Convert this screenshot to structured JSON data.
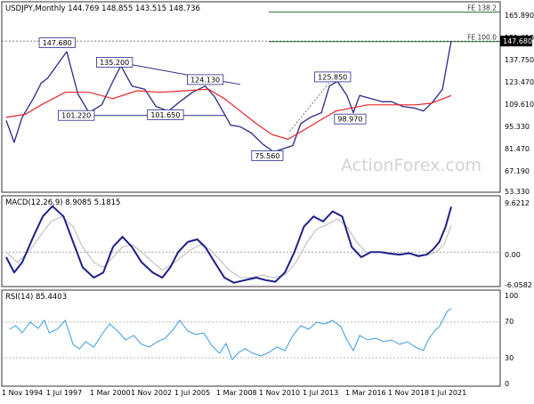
{
  "chart_data": [
    {
      "type": "candlestick",
      "title": "USDJPY,Monthly  144.769 148.855 143.515 148.736",
      "ohlc_last": {
        "open": 144.769,
        "high": 148.855,
        "low": 143.515,
        "close": 148.736
      },
      "y_ticks": [
        "165.890",
        "151.610",
        "137.750",
        "123.470",
        "109.610",
        "95.330",
        "81.470",
        "67.190",
        "53.330"
      ],
      "ylim": [
        53.33,
        167.0
      ],
      "last_price_label": "147.680",
      "fib_levels": [
        {
          "label": "FE 138.2",
          "value": 167.2
        },
        {
          "label": "FE 100.0",
          "value": 148.4
        }
      ],
      "annotations": [
        {
          "label": "147.680",
          "x_year": 1998.0,
          "value": 147.68
        },
        {
          "label": "135.200",
          "x_year": 2001.6,
          "value": 135.2
        },
        {
          "label": "124.130",
          "x_year": 2007.3,
          "value": 124.13
        },
        {
          "label": "101.220",
          "x_year": 1999.2,
          "value": 101.22
        },
        {
          "label": "101.650",
          "x_year": 2004.8,
          "value": 101.65
        },
        {
          "label": "125.850",
          "x_year": 2015.3,
          "value": 125.85
        },
        {
          "label": "98.970",
          "x_year": 2016.4,
          "value": 98.97
        },
        {
          "label": "75.560",
          "x_year": 2011.2,
          "value": 75.56
        }
      ],
      "x_labels": [
        "1 Nov 1994",
        "1 Jul 1997",
        "1 Mar 2000",
        "1 Nov 2002",
        "1 Jul 2005",
        "1 Mar 2008",
        "1 Nov 2010",
        "1 Jul 2013",
        "1 Mar 2016",
        "1 Nov 2018",
        "1 Jul 2021"
      ],
      "price_series": [
        [
          1994.8,
          98
        ],
        [
          1995.3,
          84
        ],
        [
          1995.8,
          100
        ],
        [
          1996.5,
          112
        ],
        [
          1997.0,
          122
        ],
        [
          1997.4,
          125
        ],
        [
          1998.6,
          142
        ],
        [
          1999.3,
          115
        ],
        [
          2000.0,
          103
        ],
        [
          2000.8,
          108
        ],
        [
          2001.5,
          123
        ],
        [
          2002.0,
          133
        ],
        [
          2002.7,
          120
        ],
        [
          2003.5,
          118
        ],
        [
          2004.2,
          107
        ],
        [
          2005.0,
          104
        ],
        [
          2005.7,
          110
        ],
        [
          2006.5,
          116
        ],
        [
          2007.3,
          120
        ],
        [
          2007.9,
          113
        ],
        [
          2008.4,
          104
        ],
        [
          2008.9,
          95
        ],
        [
          2009.5,
          94
        ],
        [
          2010.2,
          90
        ],
        [
          2010.9,
          83
        ],
        [
          2011.6,
          78
        ],
        [
          2012.2,
          80
        ],
        [
          2012.8,
          82
        ],
        [
          2013.3,
          96
        ],
        [
          2013.9,
          100
        ],
        [
          2014.6,
          103
        ],
        [
          2015.1,
          120
        ],
        [
          2015.6,
          123
        ],
        [
          2016.2,
          114
        ],
        [
          2016.6,
          103
        ],
        [
          2017.0,
          114
        ],
        [
          2017.7,
          112
        ],
        [
          2018.4,
          110
        ],
        [
          2019.0,
          110
        ],
        [
          2019.7,
          107
        ],
        [
          2020.4,
          106
        ],
        [
          2021.0,
          104
        ],
        [
          2021.6,
          110
        ],
        [
          2022.2,
          118
        ],
        [
          2022.5,
          135
        ],
        [
          2022.75,
          148.7
        ]
      ],
      "ma_series": [
        [
          1994.8,
          100
        ],
        [
          1996.0,
          102
        ],
        [
          1997.0,
          108
        ],
        [
          1998.5,
          116
        ],
        [
          2000.0,
          116
        ],
        [
          2001.5,
          112
        ],
        [
          2003.0,
          117
        ],
        [
          2004.5,
          116
        ],
        [
          2006.0,
          117
        ],
        [
          2007.5,
          118
        ],
        [
          2008.5,
          112
        ],
        [
          2009.5,
          104
        ],
        [
          2010.5,
          96
        ],
        [
          2011.5,
          89
        ],
        [
          2012.5,
          86
        ],
        [
          2013.5,
          92
        ],
        [
          2014.5,
          98
        ],
        [
          2015.5,
          104
        ],
        [
          2016.5,
          106
        ],
        [
          2017.5,
          108
        ],
        [
          2018.5,
          108
        ],
        [
          2019.5,
          108
        ],
        [
          2020.5,
          108
        ],
        [
          2021.5,
          109
        ],
        [
          2022.75,
          114
        ]
      ]
    },
    {
      "type": "line",
      "title": "MACD(12,26,9) 8.9085 5.1815",
      "y_ticks": [
        "9.6212",
        "0.00",
        "-6.0582"
      ],
      "ylim": [
        -6.4,
        10.0
      ],
      "series": [
        {
          "name": "MACD",
          "values": [
            [
              1994.8,
              -1
            ],
            [
              1995.3,
              -4
            ],
            [
              1995.8,
              -2
            ],
            [
              1996.5,
              3
            ],
            [
              1997.1,
              7
            ],
            [
              1997.7,
              9
            ],
            [
              1998.4,
              7
            ],
            [
              1999.0,
              2
            ],
            [
              1999.6,
              -3
            ],
            [
              2000.3,
              -5
            ],
            [
              2000.9,
              -4
            ],
            [
              2001.5,
              1
            ],
            [
              2002.1,
              3
            ],
            [
              2002.7,
              1
            ],
            [
              2003.3,
              -2
            ],
            [
              2004.0,
              -4
            ],
            [
              2004.6,
              -5
            ],
            [
              2005.1,
              -3
            ],
            [
              2005.6,
              0
            ],
            [
              2006.2,
              2
            ],
            [
              2006.8,
              2.5
            ],
            [
              2007.3,
              1
            ],
            [
              2007.9,
              -2
            ],
            [
              2008.5,
              -5
            ],
            [
              2009.1,
              -6
            ],
            [
              2009.8,
              -5.5
            ],
            [
              2010.5,
              -5
            ],
            [
              2011.1,
              -5.5
            ],
            [
              2011.7,
              -5.8
            ],
            [
              2012.3,
              -4
            ],
            [
              2012.9,
              0
            ],
            [
              2013.5,
              5
            ],
            [
              2014.1,
              7
            ],
            [
              2014.7,
              6
            ],
            [
              2015.3,
              8
            ],
            [
              2015.9,
              7
            ],
            [
              2016.5,
              1
            ],
            [
              2017.1,
              -1
            ],
            [
              2017.7,
              0
            ],
            [
              2018.3,
              0
            ],
            [
              2018.9,
              -0.3
            ],
            [
              2019.5,
              -0.5
            ],
            [
              2020.1,
              -0.2
            ],
            [
              2020.7,
              -0.8
            ],
            [
              2021.2,
              -0.5
            ],
            [
              2021.6,
              0.5
            ],
            [
              2022.0,
              2
            ],
            [
              2022.4,
              5
            ],
            [
              2022.75,
              8.9
            ]
          ]
        },
        {
          "name": "Signal",
          "values": [
            [
              1994.8,
              0
            ],
            [
              1995.5,
              -2
            ],
            [
              1996.2,
              0
            ],
            [
              1996.9,
              3
            ],
            [
              1997.6,
              6
            ],
            [
              1998.3,
              7
            ],
            [
              1999.0,
              5
            ],
            [
              1999.6,
              1
            ],
            [
              2000.3,
              -2
            ],
            [
              2000.9,
              -3
            ],
            [
              2001.5,
              -1
            ],
            [
              2002.1,
              1
            ],
            [
              2002.7,
              1.5
            ],
            [
              2003.3,
              0
            ],
            [
              2004.0,
              -2
            ],
            [
              2004.6,
              -3.5
            ],
            [
              2005.2,
              -2.5
            ],
            [
              2005.8,
              -1
            ],
            [
              2006.4,
              0.5
            ],
            [
              2007.0,
              1.5
            ],
            [
              2007.6,
              0.5
            ],
            [
              2008.2,
              -1.5
            ],
            [
              2008.8,
              -3.5
            ],
            [
              2009.5,
              -5
            ],
            [
              2010.2,
              -5
            ],
            [
              2010.9,
              -4.5
            ],
            [
              2011.6,
              -5
            ],
            [
              2012.3,
              -4.5
            ],
            [
              2013.0,
              -2
            ],
            [
              2013.7,
              2
            ],
            [
              2014.3,
              4.5
            ],
            [
              2015.0,
              5.5
            ],
            [
              2015.6,
              6.5
            ],
            [
              2016.2,
              5
            ],
            [
              2016.8,
              2
            ],
            [
              2017.4,
              0
            ],
            [
              2018.0,
              0
            ],
            [
              2018.6,
              0
            ],
            [
              2019.3,
              -0.3
            ],
            [
              2020.0,
              -0.3
            ],
            [
              2020.7,
              -0.5
            ],
            [
              2021.3,
              -0.5
            ],
            [
              2021.8,
              0
            ],
            [
              2022.3,
              1.5
            ],
            [
              2022.75,
              5.2
            ]
          ]
        }
      ]
    },
    {
      "type": "line",
      "title": "RSI(14) 85.4403",
      "y_ticks": [
        "100",
        "70",
        "30",
        "0"
      ],
      "ylim": [
        0,
        100
      ],
      "levels": [
        70,
        30
      ],
      "series": [
        {
          "name": "RSI",
          "values": [
            [
              1995.0,
              62
            ],
            [
              1995.4,
              66
            ],
            [
              1995.8,
              58
            ],
            [
              1996.3,
              70
            ],
            [
              1996.8,
              63
            ],
            [
              1997.2,
              72
            ],
            [
              1997.5,
              58
            ],
            [
              1998.0,
              62
            ],
            [
              1998.5,
              72
            ],
            [
              1999.0,
              45
            ],
            [
              1999.4,
              40
            ],
            [
              1999.8,
              48
            ],
            [
              2000.3,
              42
            ],
            [
              2000.8,
              56
            ],
            [
              2001.3,
              68
            ],
            [
              2001.8,
              60
            ],
            [
              2002.3,
              50
            ],
            [
              2002.8,
              55
            ],
            [
              2003.3,
              45
            ],
            [
              2003.8,
              42
            ],
            [
              2004.3,
              48
            ],
            [
              2004.8,
              52
            ],
            [
              2005.3,
              62
            ],
            [
              2005.7,
              72
            ],
            [
              2006.2,
              60
            ],
            [
              2006.7,
              56
            ],
            [
              2007.2,
              58
            ],
            [
              2007.7,
              44
            ],
            [
              2008.2,
              35
            ],
            [
              2008.6,
              46
            ],
            [
              2009.0,
              28
            ],
            [
              2009.4,
              36
            ],
            [
              2009.8,
              40
            ],
            [
              2010.3,
              35
            ],
            [
              2010.8,
              32
            ],
            [
              2011.3,
              36
            ],
            [
              2011.8,
              42
            ],
            [
              2012.3,
              38
            ],
            [
              2012.8,
              55
            ],
            [
              2013.3,
              66
            ],
            [
              2013.8,
              62
            ],
            [
              2014.3,
              70
            ],
            [
              2014.8,
              68
            ],
            [
              2015.3,
              72
            ],
            [
              2015.8,
              65
            ],
            [
              2016.2,
              50
            ],
            [
              2016.6,
              38
            ],
            [
              2017.0,
              55
            ],
            [
              2017.5,
              50
            ],
            [
              2018.0,
              52
            ],
            [
              2018.5,
              48
            ],
            [
              2019.0,
              50
            ],
            [
              2019.5,
              45
            ],
            [
              2020.0,
              48
            ],
            [
              2020.5,
              42
            ],
            [
              2021.0,
              38
            ],
            [
              2021.3,
              50
            ],
            [
              2021.7,
              60
            ],
            [
              2022.0,
              65
            ],
            [
              2022.3,
              75
            ],
            [
              2022.5,
              82
            ],
            [
              2022.75,
              85.4
            ]
          ]
        }
      ]
    }
  ],
  "watermark": "ActionForex.com",
  "colors": {
    "price": "#2b2b88",
    "ma": "#e8242a",
    "macd": "#1f1f8a",
    "signal": "#b8b8b8",
    "rsi": "#3a9be0",
    "fib": "#2a6b33",
    "axis": "#333333",
    "grid": "#9a9a9a",
    "watermark": "#d2d2d2"
  }
}
